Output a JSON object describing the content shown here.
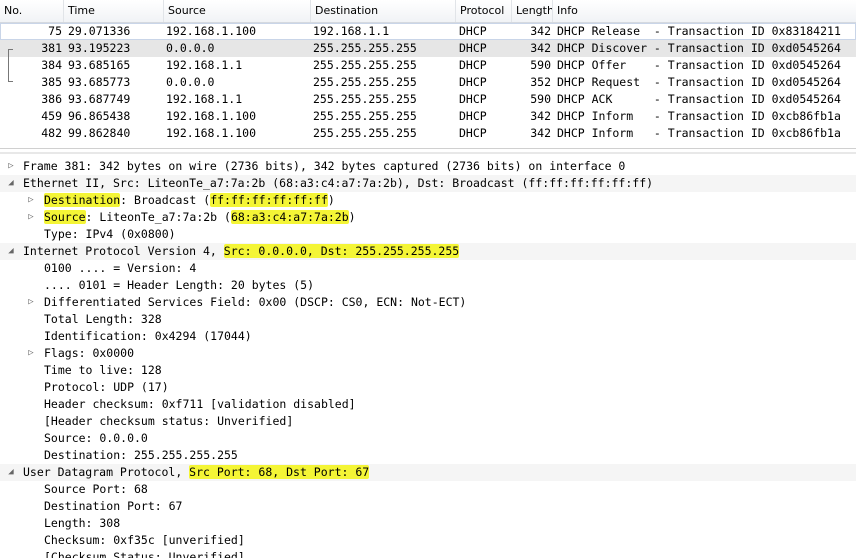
{
  "packet_list": {
    "columns": [
      "No.",
      "Time",
      "Source",
      "Destination",
      "Protocol",
      "Length",
      "Info"
    ],
    "rows": [
      {
        "no": "75",
        "time": "29.071336",
        "source": "192.168.1.100",
        "destination": "192.168.1.1",
        "protocol": "DHCP",
        "length": "342",
        "info": "DHCP Release  - Transaction ID 0x83184211"
      },
      {
        "no": "381",
        "time": "93.195223",
        "source": "0.0.0.0",
        "destination": "255.255.255.255",
        "protocol": "DHCP",
        "length": "342",
        "info": "DHCP Discover - Transaction ID 0xd0545264"
      },
      {
        "no": "384",
        "time": "93.685165",
        "source": "192.168.1.1",
        "destination": "255.255.255.255",
        "protocol": "DHCP",
        "length": "590",
        "info": "DHCP Offer    - Transaction ID 0xd0545264"
      },
      {
        "no": "385",
        "time": "93.685773",
        "source": "0.0.0.0",
        "destination": "255.255.255.255",
        "protocol": "DHCP",
        "length": "352",
        "info": "DHCP Request  - Transaction ID 0xd0545264"
      },
      {
        "no": "386",
        "time": "93.687749",
        "source": "192.168.1.1",
        "destination": "255.255.255.255",
        "protocol": "DHCP",
        "length": "590",
        "info": "DHCP ACK      - Transaction ID 0xd0545264"
      },
      {
        "no": "459",
        "time": "96.865438",
        "source": "192.168.1.100",
        "destination": "255.255.255.255",
        "protocol": "DHCP",
        "length": "342",
        "info": "DHCP Inform   - Transaction ID 0xcb86fb1a"
      },
      {
        "no": "482",
        "time": "99.862840",
        "source": "192.168.1.100",
        "destination": "255.255.255.255",
        "protocol": "DHCP",
        "length": "342",
        "info": "DHCP Inform   - Transaction ID 0xcb86fb1a"
      }
    ]
  },
  "details": {
    "lines": [
      {
        "indent": 0,
        "toggle": "collapsed",
        "proto": false,
        "parts": [
          {
            "t": "Frame 381: 342 bytes on wire (2736 bits), 342 bytes captured (2736 bits) on interface 0"
          }
        ]
      },
      {
        "indent": 0,
        "toggle": "expanded",
        "proto": true,
        "parts": [
          {
            "t": "Ethernet II, Src: LiteonTe_a7:7a:2b (68:a3:c4:a7:7a:2b), Dst: Broadcast (ff:ff:ff:ff:ff:ff)"
          }
        ]
      },
      {
        "indent": 1,
        "toggle": "collapsed",
        "proto": false,
        "parts": [
          {
            "t": "Destination",
            "hl": true
          },
          {
            "t": ": Broadcast ("
          },
          {
            "t": "ff:ff:ff:ff:ff:ff",
            "hl": true
          },
          {
            "t": ")"
          }
        ]
      },
      {
        "indent": 1,
        "toggle": "collapsed",
        "proto": false,
        "parts": [
          {
            "t": "Source",
            "hl": true
          },
          {
            "t": ": LiteonTe_a7:7a:2b ("
          },
          {
            "t": "68:a3:c4:a7:7a:2b",
            "hl": true
          },
          {
            "t": ")"
          }
        ]
      },
      {
        "indent": 1,
        "toggle": "none",
        "proto": false,
        "parts": [
          {
            "t": "Type: IPv4 (0x0800)"
          }
        ]
      },
      {
        "indent": 0,
        "toggle": "expanded",
        "proto": true,
        "parts": [
          {
            "t": "Internet Protocol Version 4, "
          },
          {
            "t": "Src: 0.0.0.0, Dst: 255.255.255.255",
            "hl": true
          }
        ]
      },
      {
        "indent": 1,
        "toggle": "none",
        "proto": false,
        "parts": [
          {
            "t": "0100 .... = Version: 4"
          }
        ]
      },
      {
        "indent": 1,
        "toggle": "none",
        "proto": false,
        "parts": [
          {
            "t": ".... 0101 = Header Length: 20 bytes (5)"
          }
        ]
      },
      {
        "indent": 1,
        "toggle": "collapsed",
        "proto": false,
        "parts": [
          {
            "t": "Differentiated Services Field: 0x00 (DSCP: CS0, ECN: Not-ECT)"
          }
        ]
      },
      {
        "indent": 1,
        "toggle": "none",
        "proto": false,
        "parts": [
          {
            "t": "Total Length: 328"
          }
        ]
      },
      {
        "indent": 1,
        "toggle": "none",
        "proto": false,
        "parts": [
          {
            "t": "Identification: 0x4294 (17044)"
          }
        ]
      },
      {
        "indent": 1,
        "toggle": "collapsed",
        "proto": false,
        "parts": [
          {
            "t": "Flags: 0x0000"
          }
        ]
      },
      {
        "indent": 1,
        "toggle": "none",
        "proto": false,
        "parts": [
          {
            "t": "Time to live: 128"
          }
        ]
      },
      {
        "indent": 1,
        "toggle": "none",
        "proto": false,
        "parts": [
          {
            "t": "Protocol: UDP (17)"
          }
        ]
      },
      {
        "indent": 1,
        "toggle": "none",
        "proto": false,
        "parts": [
          {
            "t": "Header checksum: 0xf711 [validation disabled]"
          }
        ]
      },
      {
        "indent": 1,
        "toggle": "none",
        "proto": false,
        "parts": [
          {
            "t": "[Header checksum status: Unverified]"
          }
        ]
      },
      {
        "indent": 1,
        "toggle": "none",
        "proto": false,
        "parts": [
          {
            "t": "Source: 0.0.0.0"
          }
        ]
      },
      {
        "indent": 1,
        "toggle": "none",
        "proto": false,
        "parts": [
          {
            "t": "Destination: 255.255.255.255"
          }
        ]
      },
      {
        "indent": 0,
        "toggle": "expanded",
        "proto": true,
        "parts": [
          {
            "t": "User Datagram Protocol, "
          },
          {
            "t": "Src Port: 68, Dst Port: 67",
            "hl": true
          }
        ]
      },
      {
        "indent": 1,
        "toggle": "none",
        "proto": false,
        "parts": [
          {
            "t": "Source Port: 68"
          }
        ]
      },
      {
        "indent": 1,
        "toggle": "none",
        "proto": false,
        "parts": [
          {
            "t": "Destination Port: 67"
          }
        ]
      },
      {
        "indent": 1,
        "toggle": "none",
        "proto": false,
        "parts": [
          {
            "t": "Length: 308"
          }
        ]
      },
      {
        "indent": 1,
        "toggle": "none",
        "proto": false,
        "parts": [
          {
            "t": "Checksum: 0xf35c [unverified]"
          }
        ]
      },
      {
        "indent": 1,
        "toggle": "none",
        "proto": false,
        "parts": [
          {
            "t": "[Checksum Status: Unverified]"
          }
        ]
      }
    ]
  },
  "icons": {
    "collapsed": "triangle-right-icon",
    "expanded": "triangle-down-icon"
  },
  "colors": {
    "highlight": "#f4f536",
    "selected_row": "#e6e6e6",
    "protocol_row": "#f5f5f5"
  }
}
